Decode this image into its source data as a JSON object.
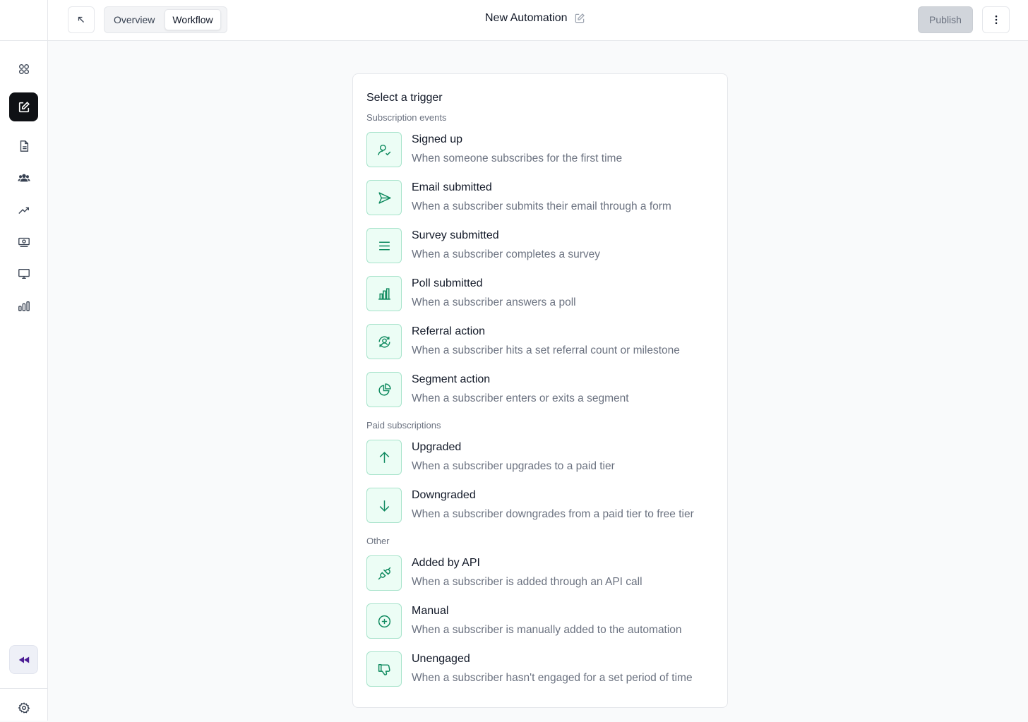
{
  "topbar": {
    "tabs": [
      "Overview",
      "Workflow"
    ],
    "active_tab": "Workflow",
    "title": "New Automation",
    "publish_label": "Publish"
  },
  "panel": {
    "title": "Select a trigger",
    "sections": [
      {
        "label": "Subscription events",
        "items": [
          {
            "icon": "user-check-icon",
            "title": "Signed up",
            "desc": "When someone subscribes for the first time"
          },
          {
            "icon": "send-icon",
            "title": "Email submitted",
            "desc": "When a subscriber submits their email through a form"
          },
          {
            "icon": "lines-icon",
            "title": "Survey submitted",
            "desc": "When a subscriber completes a survey"
          },
          {
            "icon": "bar-chart-icon",
            "title": "Poll submitted",
            "desc": "When a subscriber answers a poll"
          },
          {
            "icon": "user-refresh-icon",
            "title": "Referral action",
            "desc": "When a subscriber hits a set referral count or milestone"
          },
          {
            "icon": "pie-chart-icon",
            "title": "Segment action",
            "desc": "When a subscriber enters or exits a segment"
          }
        ]
      },
      {
        "label": "Paid subscriptions",
        "items": [
          {
            "icon": "arrow-up-icon",
            "title": "Upgraded",
            "desc": "When a subscriber upgrades to a paid tier"
          },
          {
            "icon": "arrow-down-icon",
            "title": "Downgraded",
            "desc": "When a subscriber downgrades from a paid tier to free tier"
          }
        ]
      },
      {
        "label": "Other",
        "items": [
          {
            "icon": "plug-icon",
            "title": "Added by API",
            "desc": "When a subscriber is added through an API call"
          },
          {
            "icon": "plus-circle-icon",
            "title": "Manual",
            "desc": "When a subscriber is manually added to the automation"
          },
          {
            "icon": "thumbs-down-icon",
            "title": "Unengaged",
            "desc": "When a subscriber hasn't engaged for a set period of time"
          }
        ]
      }
    ]
  },
  "colors": {
    "accent": "#0f8a5f",
    "icon_bg": "#ecfdf5",
    "active_nav": "#0f1115"
  }
}
